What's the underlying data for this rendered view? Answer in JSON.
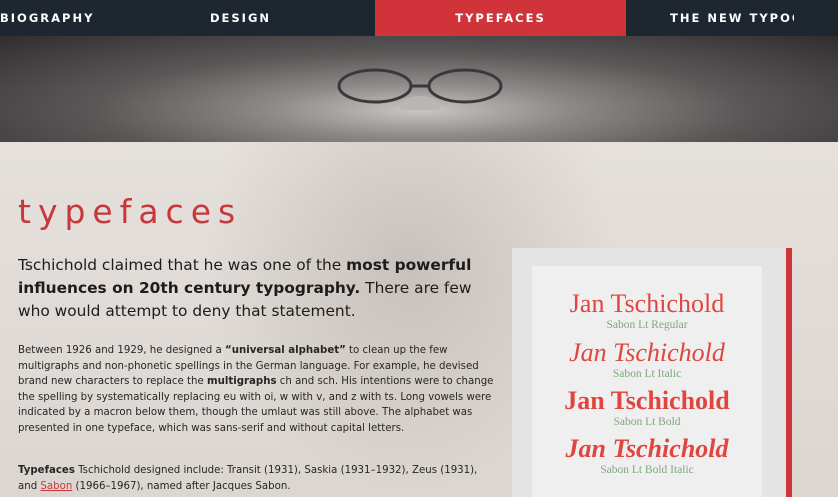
{
  "nav": {
    "items": [
      {
        "label": "BIOGRAPHY",
        "active": false
      },
      {
        "label": "DESIGN",
        "active": false
      },
      {
        "label": "TYPEFACES",
        "active": true
      },
      {
        "label": "THE NEW TYPOGR",
        "active": false
      }
    ],
    "colors": {
      "bar": "#1e2630",
      "active": "#d0343a"
    }
  },
  "page": {
    "title": "typefaces",
    "lead": {
      "part1": "Tschichold claimed that he was one of the ",
      "bold": "most powerful influences on 20th century typography.",
      "part2": " There are few who would attempt to deny that statement."
    },
    "paragraph": {
      "t1": "Between 1926 and 1929, he designed a ",
      "b1": "“universal alphabet”",
      "t2": " to clean up the few multigraphs and non-phonetic spellings in the German language. For example, he devised brand new characters to replace the ",
      "b2": "multigraphs",
      "t3": " ch and sch. His intentions were to change the spelling by systematically replacing eu with oi, w with v, and z with ts. Long vowels were indicated by a macron below them, though the umlaut was still above. The alphabet was presented in one typeface, which was sans-serif and without capital letters."
    },
    "paragraph2": {
      "b1": "Typefaces",
      "t1": " Tschichold designed include: Transit (1931), Saskia (1931–1932), Zeus (1931), and ",
      "link": "Sabon",
      "t2": " (1966–1967), named after Jacques Sabon."
    }
  },
  "specimens": [
    {
      "name": "Jan Tschichold",
      "label": "Sabon Lt Regular"
    },
    {
      "name": "Jan Tschichold",
      "label": "Sabon Lt Italic"
    },
    {
      "name": "Jan Tschichold",
      "label": "Sabon Lt Bold"
    },
    {
      "name": "Jan Tschichold",
      "label": "Sabon Lt Bold Italic"
    }
  ],
  "colors": {
    "accent": "#c8373c",
    "specimen_name": "#e0463f",
    "specimen_label": "#7fa87c"
  }
}
